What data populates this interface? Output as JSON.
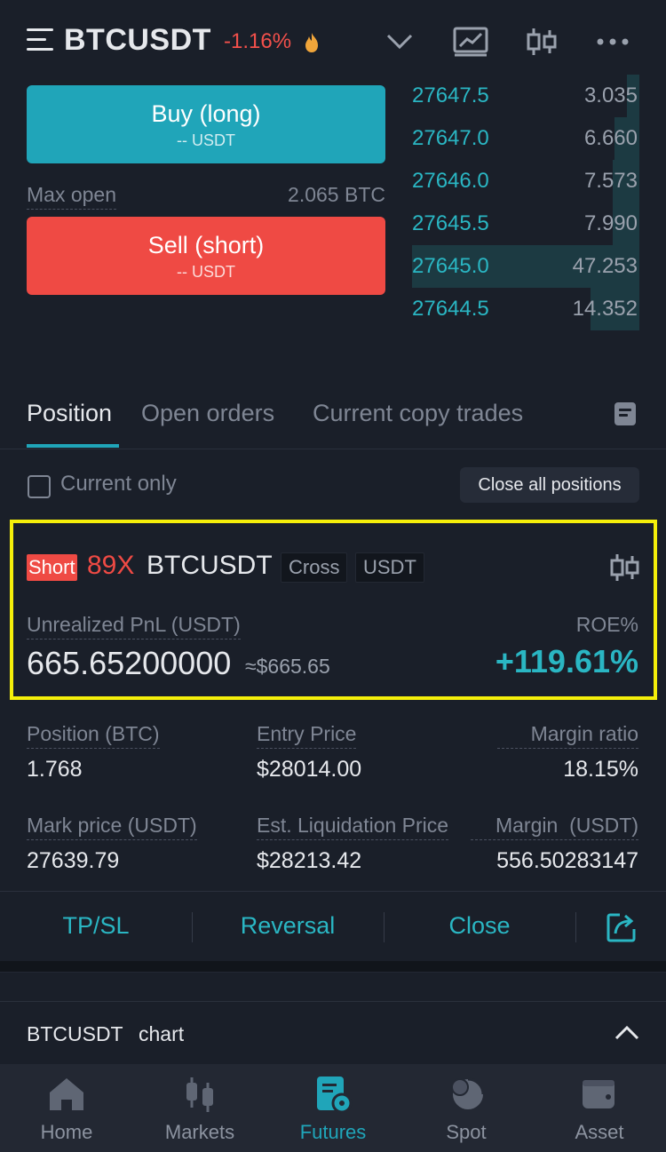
{
  "header": {
    "symbol": "BTCUSDT",
    "change": "-1.16%",
    "icons": [
      "menu-icon",
      "fire-icon",
      "chevron-down-icon",
      "chart-icon",
      "candlestick-icon",
      "more-icon"
    ]
  },
  "trade": {
    "buy_label": "Buy (long)",
    "buy_sub": "-- USDT",
    "max_open_label": "Max open",
    "max_open_value": "2.065 BTC",
    "sell_label": "Sell (short)",
    "sell_sub": "-- USDT"
  },
  "orderbook": {
    "rows": [
      {
        "price": "27647.5",
        "qty": "3.035",
        "depth": 0.08
      },
      {
        "price": "27647.0",
        "qty": "6.660",
        "depth": 0.16
      },
      {
        "price": "27646.0",
        "qty": "7.573",
        "depth": 0.17
      },
      {
        "price": "27645.5",
        "qty": "7.990",
        "depth": 0.17
      },
      {
        "price": "27645.0",
        "qty": "47.253",
        "depth": 1.0
      },
      {
        "price": "27644.5",
        "qty": "14.352",
        "depth": 0.31
      }
    ]
  },
  "tabs": {
    "items": [
      "Position",
      "Open orders",
      "Current copy trades"
    ],
    "active": "Position"
  },
  "filters": {
    "current_only": "Current only",
    "close_all": "Close all positions"
  },
  "position": {
    "side": "Short",
    "leverage": "89X",
    "symbol": "BTCUSDT",
    "margin_mode": "Cross",
    "settle": "USDT",
    "upnl_label": "Unrealized PnL (USDT)",
    "upnl_value": "665.65200000",
    "upnl_approx": "≈$665.65",
    "roe_label": "ROE%",
    "roe_value": "+119.61%",
    "details": {
      "position_label": "Position (BTC)",
      "position_value": "1.768",
      "entry_label": "Entry Price",
      "entry_value": "$28014.00",
      "margin_ratio_label": "Margin ratio",
      "margin_ratio_value": "18.15%",
      "mark_label": "Mark price (USDT)",
      "mark_value": "27639.79",
      "liq_label": "Est. Liquidation Price",
      "liq_value": "$28213.42",
      "margin_label": "Margin  (USDT)",
      "margin_value": "556.50283147"
    }
  },
  "actions": {
    "tpsl": "TP/SL",
    "reversal": "Reversal",
    "close": "Close"
  },
  "chart_section": {
    "symbol": "BTCUSDT",
    "label": "chart"
  },
  "bottom_nav": {
    "items": [
      "Home",
      "Markets",
      "Futures",
      "Spot",
      "Asset"
    ],
    "active": "Futures"
  },
  "colors": {
    "background": "#1a1f29",
    "accent": "#20a5b9",
    "sell": "#ef4a44",
    "highlight": "#f5ef0a"
  }
}
